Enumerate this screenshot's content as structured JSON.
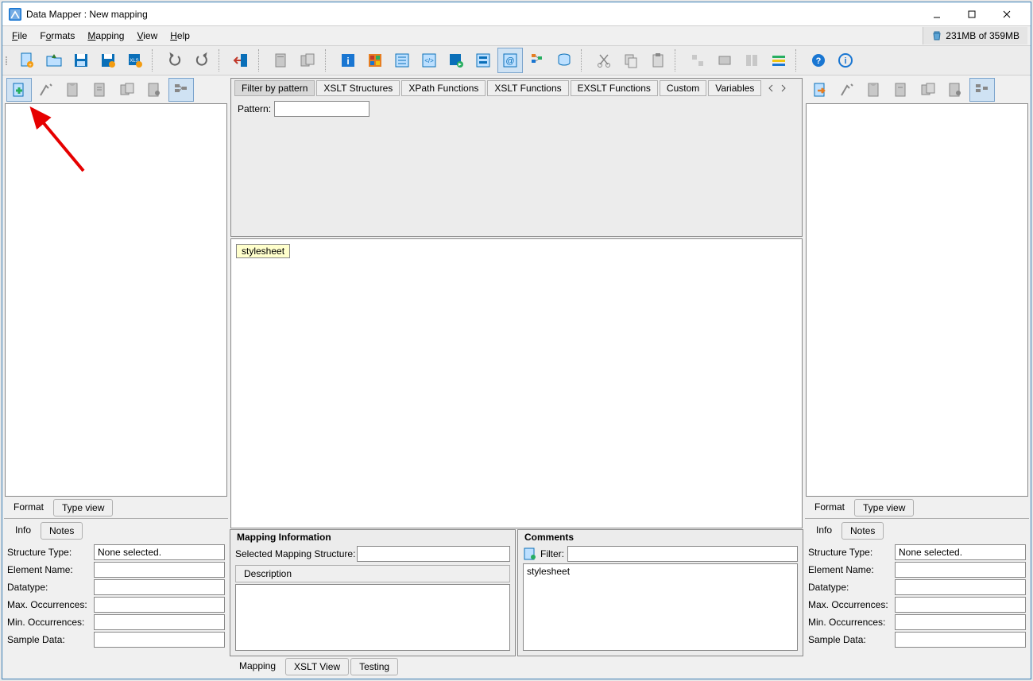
{
  "title": "Data Mapper : New mapping",
  "memory": "231MB of 359MB",
  "menu": {
    "file": "File",
    "formats": "Formats",
    "mapping": "Mapping",
    "view": "View",
    "help": "Help"
  },
  "center_tabs": [
    "Filter by pattern",
    "XSLT Structures",
    "XPath Functions",
    "XSLT Functions",
    "EXSLT Functions",
    "Custom",
    "Variables"
  ],
  "pattern_label": "Pattern:",
  "stylesheet_node": "stylesheet",
  "left": {
    "tab_format": "Format",
    "tab_typeview": "Type view",
    "tab_info": "Info",
    "tab_notes": "Notes",
    "fields": {
      "structure_type": "Structure Type:",
      "structure_type_val": "None selected.",
      "element_name": "Element Name:",
      "element_name_val": "",
      "datatype": "Datatype:",
      "datatype_val": "",
      "max_occ": "Max. Occurrences:",
      "max_occ_val": "",
      "min_occ": "Min. Occurrences:",
      "min_occ_val": "",
      "sample": "Sample Data:",
      "sample_val": ""
    }
  },
  "right": {
    "tab_format": "Format",
    "tab_typeview": "Type view",
    "tab_info": "Info",
    "tab_notes": "Notes",
    "fields": {
      "structure_type": "Structure Type:",
      "structure_type_val": "None selected.",
      "element_name": "Element Name:",
      "element_name_val": "",
      "datatype": "Datatype:",
      "datatype_val": "",
      "max_occ": "Max. Occurrences:",
      "max_occ_val": "",
      "min_occ": "Min. Occurrences:",
      "min_occ_val": "",
      "sample": "Sample Data:",
      "sample_val": ""
    }
  },
  "mapping_info": {
    "legend": "Mapping Information",
    "sel_label": "Selected Mapping Structure:",
    "sel_value": "",
    "desc_tab": "Description"
  },
  "comments": {
    "legend": "Comments",
    "filter_label": "Filter:",
    "filter_value": "",
    "list_item": "stylesheet"
  },
  "bottom_tabs": {
    "mapping": "Mapping",
    "xslt_view": "XSLT View",
    "testing": "Testing"
  }
}
